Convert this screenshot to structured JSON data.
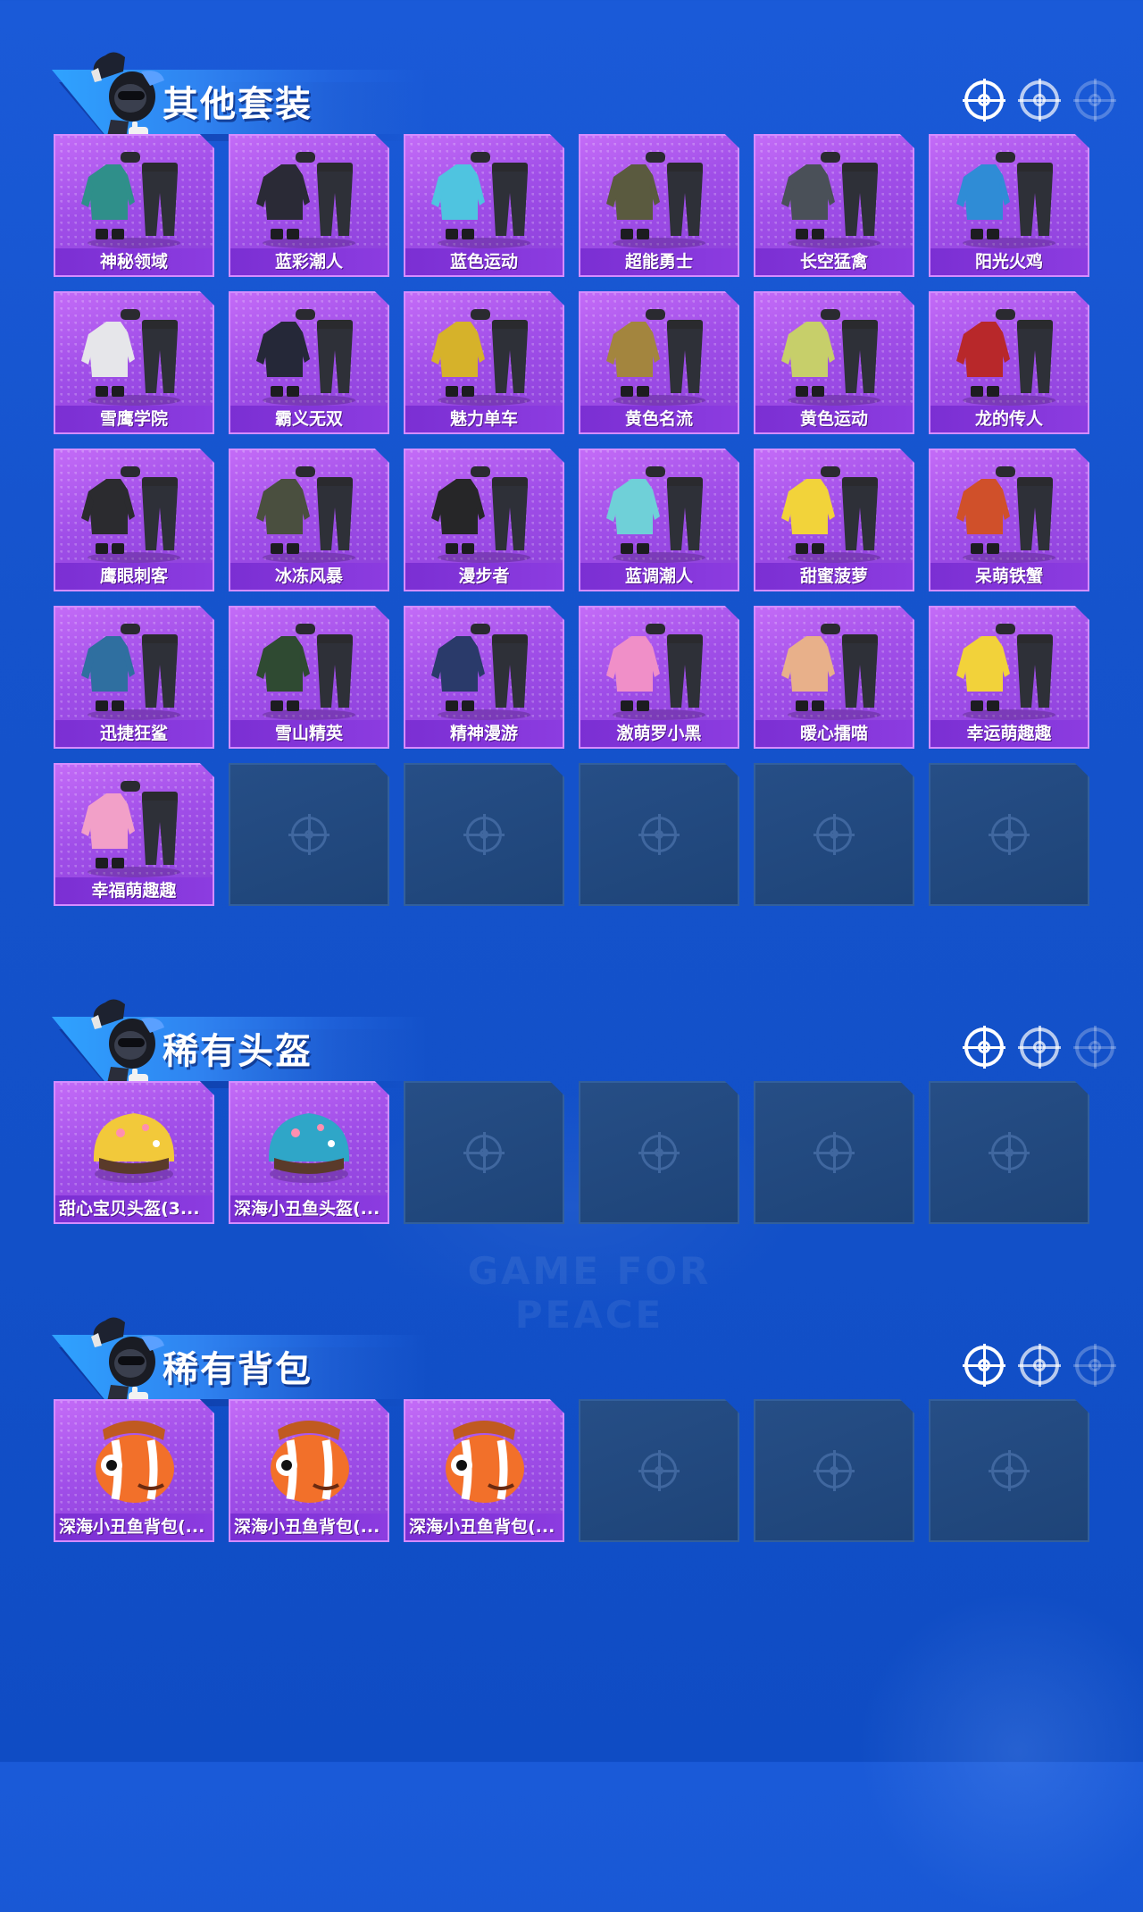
{
  "sections": [
    {
      "title": "其他套装",
      "icons": [
        "crosshair-icon",
        "crosshair-icon",
        "crosshair-icon"
      ],
      "items": [
        {
          "label": "神秘领域",
          "art": "outfit",
          "color": "#2f8f8a"
        },
        {
          "label": "蓝彩潮人",
          "art": "outfit",
          "color": "#2a2a36"
        },
        {
          "label": "蓝色运动",
          "art": "outfit",
          "color": "#4fc4e0"
        },
        {
          "label": "超能勇士",
          "art": "outfit",
          "color": "#5a5a3f"
        },
        {
          "label": "长空猛禽",
          "art": "outfit",
          "color": "#4a5058"
        },
        {
          "label": "阳光火鸡",
          "art": "outfit",
          "color": "#2f8cd6"
        },
        {
          "label": "雪鹰学院",
          "art": "outfit",
          "color": "#e6e6ea"
        },
        {
          "label": "霸义无双",
          "art": "outfit",
          "color": "#252838"
        },
        {
          "label": "魅力单车",
          "art": "outfit",
          "color": "#d6b22a"
        },
        {
          "label": "黄色名流",
          "art": "outfit",
          "color": "#a3853e"
        },
        {
          "label": "黄色运动",
          "art": "outfit",
          "color": "#c7cf6a"
        },
        {
          "label": "龙的传人",
          "art": "outfit",
          "color": "#b8282a"
        },
        {
          "label": "鹰眼刺客",
          "art": "outfit",
          "color": "#2b2b2f"
        },
        {
          "label": "冰冻风暴",
          "art": "outfit",
          "color": "#4a4f3f"
        },
        {
          "label": "漫步者",
          "art": "outfit",
          "color": "#262628"
        },
        {
          "label": "蓝调潮人",
          "art": "outfit",
          "color": "#6fd0d8"
        },
        {
          "label": "甜蜜菠萝",
          "art": "outfit",
          "color": "#f2d33a"
        },
        {
          "label": "呆萌铁蟹",
          "art": "outfit",
          "color": "#d0502a"
        },
        {
          "label": "迅捷狂鲨",
          "art": "outfit",
          "color": "#2f6fa0"
        },
        {
          "label": "雪山精英",
          "art": "outfit",
          "color": "#2f4a32"
        },
        {
          "label": "精神漫游",
          "art": "outfit",
          "color": "#2a3a6a"
        },
        {
          "label": "激萌罗小黑",
          "art": "outfit",
          "color": "#f08fc8"
        },
        {
          "label": "暖心擂喵",
          "art": "outfit",
          "color": "#e8b08a"
        },
        {
          "label": "幸运萌趣趣",
          "art": "outfit",
          "color": "#f2d23a"
        },
        {
          "label": "幸福萌趣趣",
          "art": "outfit",
          "color": "#f2a0c8"
        }
      ],
      "empty_count": 5
    },
    {
      "title": "稀有头盔",
      "icons": [
        "crosshair-icon",
        "crosshair-icon",
        "crosshair-icon"
      ],
      "items": [
        {
          "label": "甜心宝贝头盔(3...",
          "art": "helmet",
          "color": "#f2c93a"
        },
        {
          "label": "深海小丑鱼头盔(...",
          "art": "helmet",
          "color": "#2fa6c8"
        }
      ],
      "empty_count": 4
    },
    {
      "title": "稀有背包",
      "icons": [
        "crosshair-icon",
        "crosshair-icon",
        "crosshair-icon"
      ],
      "items": [
        {
          "label": "深海小丑鱼背包(...",
          "art": "backpack",
          "color": "#f2702a"
        },
        {
          "label": "深海小丑鱼背包(...",
          "art": "backpack",
          "color": "#f2702a"
        },
        {
          "label": "深海小丑鱼背包(...",
          "art": "backpack",
          "color": "#f2702a"
        }
      ],
      "empty_count": 3
    }
  ],
  "watermark": "GAME FOR PEACE"
}
